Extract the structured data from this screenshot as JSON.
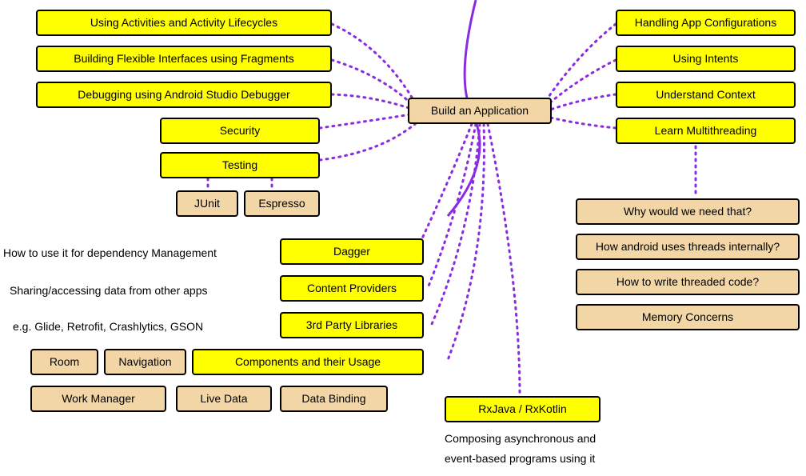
{
  "center": {
    "label": "Build an Application"
  },
  "left_top": [
    "Using Activities and Activity Lifecycles",
    "Building Flexible Interfaces using Fragments",
    "Debugging using Android Studio Debugger",
    "Security",
    "Testing"
  ],
  "testing_sub": [
    "JUnit",
    "Espresso"
  ],
  "right_top": [
    "Handling App Configurations",
    "Using Intents",
    "Understand Context",
    "Learn Multithreading"
  ],
  "multithreading_sub": [
    "Why would we need that?",
    "How android uses threads internally?",
    "How to write threaded code?",
    "Memory Concerns"
  ],
  "mid_yellow": {
    "dagger": "Dagger",
    "content_providers": "Content Providers",
    "third_party": "3rd Party Libraries",
    "components": "Components and their Usage"
  },
  "mid_labels": {
    "dagger": "How to use it for dependency Management",
    "content_providers": "Sharing/accessing data from other apps",
    "third_party": "e.g. Glide, Retrofit, Crashlytics, GSON"
  },
  "components_sub": [
    "Room",
    "Navigation",
    "Work Manager",
    "Live Data",
    "Data Binding"
  ],
  "rx": {
    "label": "RxJava / RxKotlin",
    "desc1": "Composing asynchronous and",
    "desc2": "event-based programs using it"
  }
}
